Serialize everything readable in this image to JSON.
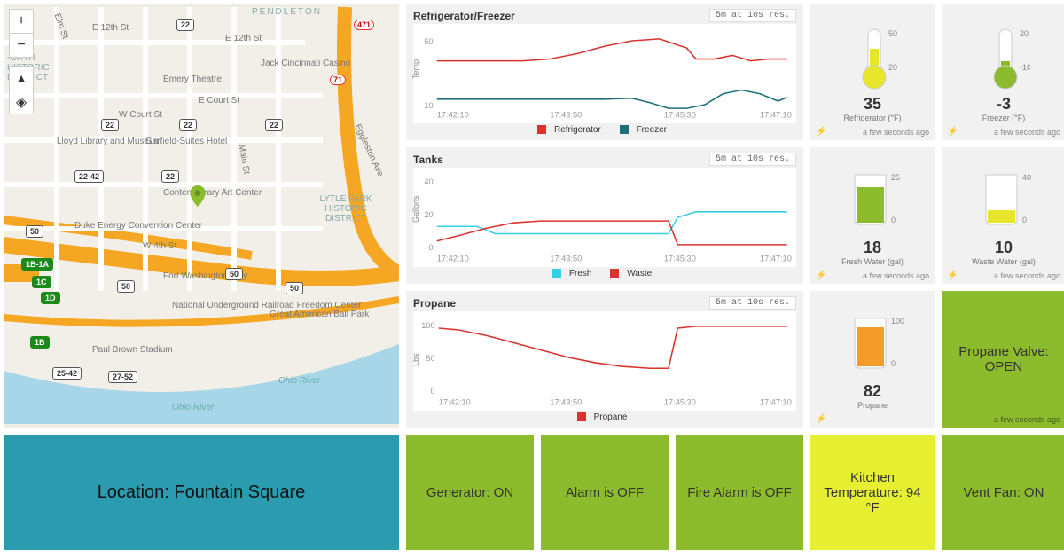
{
  "map": {
    "marker_location": "Fountain Square",
    "labels": [
      "PENDLETON",
      "E 12th St",
      "E 12th St",
      "Jack Cincinnati Casino",
      "Emery Theatre",
      "E Court St",
      "W Court St",
      "Lloyd Library and Museum",
      "Garfield-Suites Hotel",
      "Contemporary Art Center",
      "Duke Energy Convention Center",
      "W 4th St",
      "Fort Washington Way",
      "National Underground Railroad Freedom Center",
      "Great American Ball Park",
      "Paul Brown Stadium",
      "Ohio River",
      "Ohio River",
      "LYTLE PARK HISTORIC DISTRICT",
      "Eggleston Ave",
      "Main St",
      "Elm St",
      "-ORTH HISTORIC DISTRICT"
    ],
    "shields": [
      "22-42",
      "22",
      "22",
      "22",
      "22",
      "22",
      "50",
      "1B-1A",
      "1C",
      "1D",
      "25-42",
      "1B",
      "27-52",
      "471",
      "71",
      "50",
      "50",
      "50"
    ]
  },
  "charts": {
    "refrigerator": {
      "title": "Refrigerator/Freezer",
      "resolution": "5m at 10s res.",
      "axis_label": "Temp",
      "legend": [
        "Refrigerator",
        "Freezer"
      ],
      "xticks": [
        "17:42:10",
        "17:43:50",
        "17:45:30",
        "17:47:10"
      ],
      "yticks": [
        "-10",
        "50"
      ]
    },
    "tanks": {
      "title": "Tanks",
      "resolution": "5m at 10s res.",
      "axis_label": "Gallons",
      "legend": [
        "Fresh",
        "Waste"
      ],
      "xticks": [
        "17:42:10",
        "17:43:50",
        "17:45:30",
        "17:47:10"
      ],
      "yticks": [
        "0",
        "20",
        "40"
      ]
    },
    "propane": {
      "title": "Propane",
      "resolution": "5m at 10s res.",
      "axis_label": "Lbs",
      "legend": [
        "Propane"
      ],
      "xticks": [
        "17:42:10",
        "17:43:50",
        "17:45:30",
        "17:47:10"
      ],
      "yticks": [
        "0",
        "50",
        "100"
      ]
    }
  },
  "gauges": {
    "refrigerator": {
      "value": "35",
      "label": "Refrigerator (°F)",
      "time": "a few seconds ago",
      "scale": [
        "20",
        "50"
      ]
    },
    "freezer": {
      "value": "-3",
      "label": "Freezer (°F)",
      "time": "a few seconds ago",
      "scale": [
        "-10",
        "20"
      ]
    },
    "fresh": {
      "value": "18",
      "label": "Fresh Water (gal)",
      "time": "a few seconds ago",
      "scale": [
        "0",
        "25"
      ]
    },
    "waste": {
      "value": "10",
      "label": "Waste Water (gal)",
      "time": "a few seconds ago",
      "scale": [
        "0",
        "40"
      ]
    },
    "propane": {
      "value": "82",
      "label": "Propane",
      "time": "",
      "scale": [
        "0",
        "100"
      ]
    }
  },
  "tiles": {
    "propane_valve": "Propane Valve: OPEN",
    "propane_valve_time": "a few seconds ago",
    "location": "Location: Fountain Square",
    "generator": "Generator: ON",
    "alarm": "Alarm is OFF",
    "fire": "Fire Alarm is OFF",
    "kitchen": "Kitchen Temperature: 94 °F",
    "vent": "Vent Fan: ON"
  },
  "chart_data": [
    {
      "type": "line",
      "title": "Refrigerator/Freezer",
      "xlabel": "",
      "ylabel": "Temp",
      "ylim": [
        -10,
        60
      ],
      "x": [
        "17:42:10",
        "17:43:50",
        "17:45:30",
        "17:47:10"
      ],
      "series": [
        {
          "name": "Refrigerator",
          "values": [
            38,
            38,
            38,
            38,
            40,
            44,
            50,
            53,
            55,
            55,
            48,
            40,
            40,
            42,
            38,
            40,
            40,
            40
          ]
        },
        {
          "name": "Freezer",
          "values": [
            -3,
            -3,
            -3,
            -3,
            -3,
            -3,
            -3,
            -3,
            -2,
            -6,
            -10,
            -10,
            -8,
            0,
            4,
            2,
            -4,
            0
          ]
        }
      ]
    },
    {
      "type": "line",
      "title": "Tanks",
      "xlabel": "",
      "ylabel": "Gallons",
      "ylim": [
        0,
        40
      ],
      "x": [
        "17:42:10",
        "17:43:50",
        "17:45:30",
        "17:47:10"
      ],
      "series": [
        {
          "name": "Fresh",
          "values": [
            13,
            13,
            13,
            9,
            9,
            9,
            9,
            9,
            9,
            9,
            9,
            18,
            20,
            20,
            20,
            20,
            20,
            20
          ]
        },
        {
          "name": "Waste",
          "values": [
            5,
            8,
            11,
            13,
            15,
            15,
            15,
            15,
            15,
            15,
            15,
            15,
            3,
            3,
            3,
            3,
            3,
            3
          ]
        }
      ]
    },
    {
      "type": "line",
      "title": "Propane",
      "xlabel": "",
      "ylabel": "Lbs",
      "ylim": [
        0,
        110
      ],
      "x": [
        "17:42:10",
        "17:43:50",
        "17:45:30",
        "17:47:10"
      ],
      "series": [
        {
          "name": "Propane",
          "values": [
            100,
            98,
            95,
            88,
            80,
            72,
            65,
            62,
            60,
            58,
            58,
            58,
            100,
            102,
            102,
            102,
            102,
            102
          ]
        }
      ]
    }
  ]
}
